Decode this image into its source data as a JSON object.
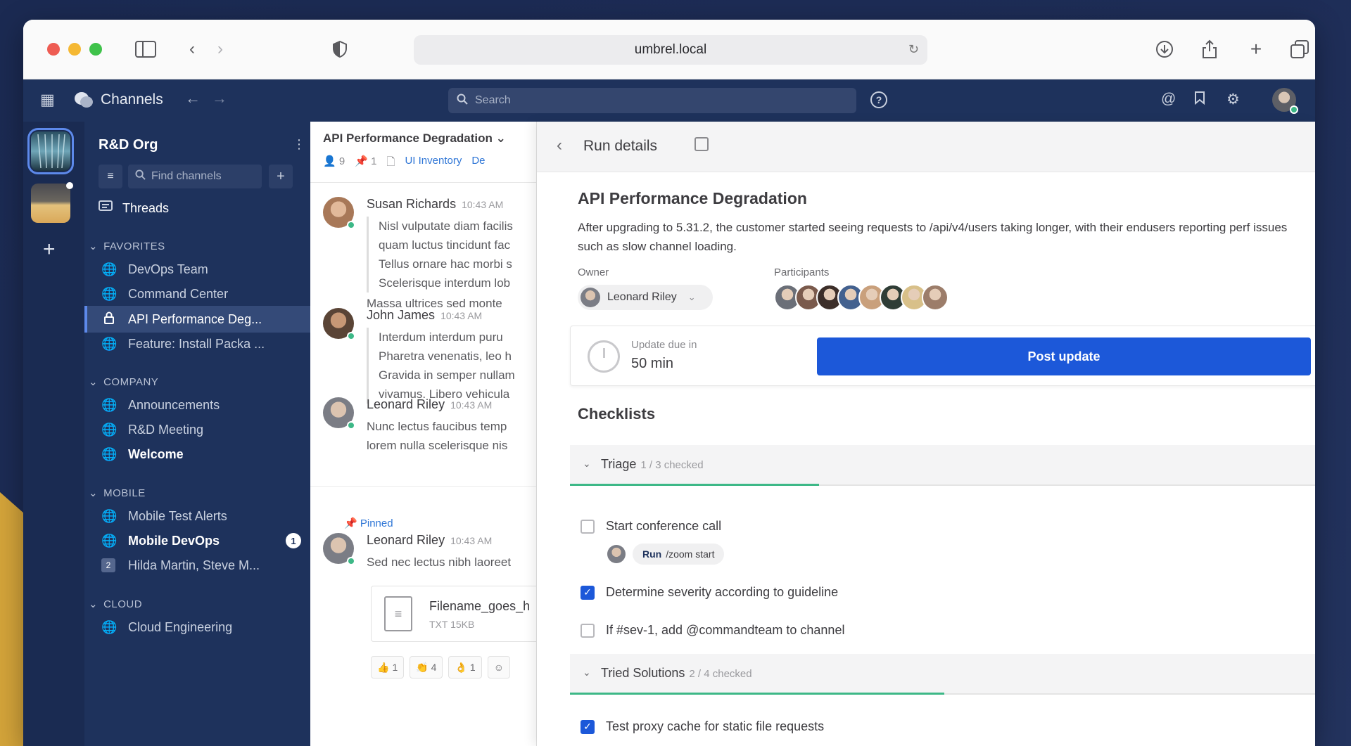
{
  "browser": {
    "url": "umbrel.local"
  },
  "app": {
    "title": "Channels",
    "search_placeholder": "Search"
  },
  "sidebar": {
    "team_name": "R&D Org",
    "find_placeholder": "Find channels",
    "threads_label": "Threads",
    "sections": [
      {
        "title": "FAVORITES",
        "items": [
          {
            "label": "DevOps Team",
            "icon": "globe-icon"
          },
          {
            "label": "Command Center",
            "icon": "globe-icon"
          },
          {
            "label": "API Performance Deg...",
            "icon": "lock-icon",
            "active": true
          },
          {
            "label": "Feature: Install Packa ...",
            "icon": "globe-icon"
          }
        ]
      },
      {
        "title": "COMPANY",
        "items": [
          {
            "label": "Announcements",
            "icon": "globe-icon"
          },
          {
            "label": "R&D Meeting",
            "icon": "globe-icon"
          },
          {
            "label": "Welcome",
            "icon": "globe-icon",
            "unread": true
          }
        ]
      },
      {
        "title": "MOBILE",
        "items": [
          {
            "label": "Mobile Test Alerts",
            "icon": "globe-icon"
          },
          {
            "label": "Mobile DevOps",
            "icon": "globe-icon",
            "unread": true,
            "badge": "1"
          },
          {
            "label": "Hilda Martin, Steve M...",
            "icon": "group-dm-icon",
            "count": "2"
          }
        ]
      },
      {
        "title": "CLOUD",
        "items": [
          {
            "label": "Cloud Engineering",
            "icon": "globe-icon"
          }
        ]
      }
    ]
  },
  "channel": {
    "title": "API Performance Degradation",
    "members": "9",
    "pinned": "1",
    "bookmarks": [
      "UI Inventory",
      "De"
    ],
    "posts": [
      {
        "author": "Susan Richards",
        "time": "10:43 AM",
        "lines": [
          "Nisl vulputate diam facilis",
          "quam luctus tincidunt fac",
          "Tellus ornare hac morbi s",
          "Scelerisque interdum lob"
        ],
        "extra": "Massa ultrices sed monte"
      },
      {
        "author": "John James",
        "time": "10:43 AM",
        "lines": [
          "Interdum interdum puru",
          "Pharetra venenatis, leo h",
          "Gravida in semper nullam",
          "vivamus. Libero vehicula"
        ]
      },
      {
        "author": "Leonard Riley",
        "time": "10:43 AM",
        "lines": [
          "Nunc lectus faucibus temp",
          "lorem nulla scelerisque nis"
        ]
      },
      {
        "author": "Leonard Riley",
        "time": "10:43 AM",
        "lines": [
          "Sed nec lectus nibh laoreet"
        ],
        "pinned_label": "Pinned"
      }
    ],
    "file": {
      "name": "Filename_goes_h",
      "meta": "TXT 15KB"
    },
    "reactions": [
      {
        "emoji": "👍",
        "count": "1"
      },
      {
        "emoji": "👏",
        "count": "4"
      },
      {
        "emoji": "👌",
        "count": "1"
      }
    ]
  },
  "run": {
    "header": "Run details",
    "name": "API Performance Degradation",
    "summary": "After upgrading to 5.31.2, the customer started seeing requests to /api/v4/users taking longer, with their endusers reporting perf issues such as slow channel loading.",
    "owner_label": "Owner",
    "owner": "Leonard Riley",
    "participants_label": "Participants",
    "participant_colors": [
      "#6b6f78",
      "#7a5a4c",
      "#3c2e29",
      "#43618f",
      "#c9a07c",
      "#2f3d36",
      "#d8c089",
      "#9c7d6a"
    ],
    "update_label": "Update due in",
    "update_value": "50 min",
    "post_update": "Post update",
    "checklists_title": "Checklists",
    "checklists": [
      {
        "name": "Triage",
        "count": "1 / 3 checked",
        "progress": 0.333,
        "items": [
          {
            "label": "Start conference call",
            "checked": false,
            "command": {
              "run": "Run",
              "text": "/zoom start"
            }
          },
          {
            "label": "Determine severity according to guideline",
            "checked": true
          },
          {
            "label": "If #sev-1, add @commandteam to channel",
            "checked": false
          }
        ]
      },
      {
        "name": "Tried Solutions",
        "count": "2 / 4 checked",
        "progress": 0.5,
        "items": [
          {
            "label": "Test proxy cache for static file requests",
            "checked": true
          }
        ]
      }
    ]
  },
  "colors": {
    "sidebar_bg": "#1e325c",
    "accent_blue": "#1c58d9",
    "online_green": "#3db887",
    "link_blue": "#2f76d6"
  }
}
